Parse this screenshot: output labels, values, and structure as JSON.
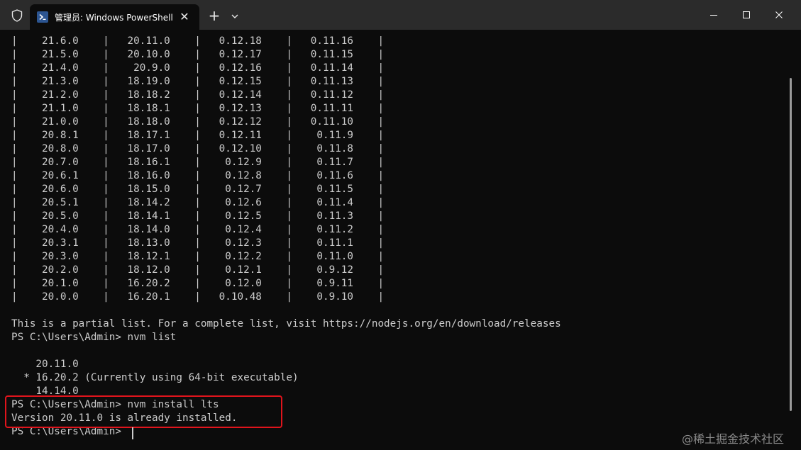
{
  "window": {
    "tab_title": "管理员: Windows PowerShell",
    "tab_close_glyph": "✕",
    "new_tab_glyph": "+"
  },
  "terminal": {
    "lines": [
      "|    21.6.0    |   20.11.0    |   0.12.18    |   0.11.16    |",
      "|    21.5.0    |   20.10.0    |   0.12.17    |   0.11.15    |",
      "|    21.4.0    |    20.9.0    |   0.12.16    |   0.11.14    |",
      "|    21.3.0    |   18.19.0    |   0.12.15    |   0.11.13    |",
      "|    21.2.0    |   18.18.2    |   0.12.14    |   0.11.12    |",
      "|    21.1.0    |   18.18.1    |   0.12.13    |   0.11.11    |",
      "|    21.0.0    |   18.18.0    |   0.12.12    |   0.11.10    |",
      "|    20.8.1    |   18.17.1    |   0.12.11    |    0.11.9    |",
      "|    20.8.0    |   18.17.0    |   0.12.10    |    0.11.8    |",
      "|    20.7.0    |   18.16.1    |    0.12.9    |    0.11.7    |",
      "|    20.6.1    |   18.16.0    |    0.12.8    |    0.11.6    |",
      "|    20.6.0    |   18.15.0    |    0.12.7    |    0.11.5    |",
      "|    20.5.1    |   18.14.2    |    0.12.6    |    0.11.4    |",
      "|    20.5.0    |   18.14.1    |    0.12.5    |    0.11.3    |",
      "|    20.4.0    |   18.14.0    |    0.12.4    |    0.11.2    |",
      "|    20.3.1    |   18.13.0    |    0.12.3    |    0.11.1    |",
      "|    20.3.0    |   18.12.1    |    0.12.2    |    0.11.0    |",
      "|    20.2.0    |   18.12.0    |    0.12.1    |    0.9.12    |",
      "|    20.1.0    |   16.20.2    |    0.12.0    |    0.9.11    |",
      "|    20.0.0    |   16.20.1    |   0.10.48    |    0.9.10    |",
      "",
      "This is a partial list. For a complete list, visit https://nodejs.org/en/download/releases",
      "PS C:\\Users\\Admin> nvm list",
      "",
      "    20.11.0",
      "  * 16.20.2 (Currently using 64-bit executable)",
      "    14.14.0",
      "PS C:\\Users\\Admin> nvm install lts",
      "Version 20.11.0 is already installed.",
      "PS C:\\Users\\Admin> "
    ]
  },
  "watermark": "@稀土掘金技术社区",
  "colors": {
    "titlebar": "#2b2b2b",
    "terminal_bg": "#0c0c0c",
    "terminal_fg": "#cccccc",
    "highlight_border": "#e0141c"
  }
}
